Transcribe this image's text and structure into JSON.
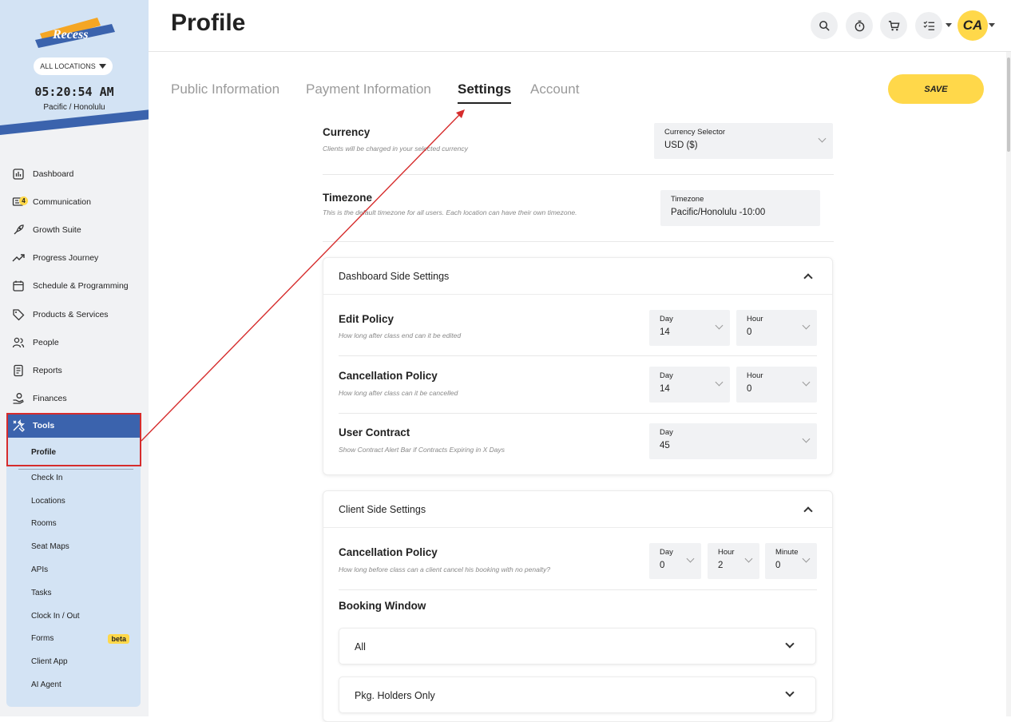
{
  "brand": {
    "logo_text": "Recess",
    "location_selector": "ALL LOCATIONS",
    "clock": "05:20:54 AM",
    "timezone": "Pacific / Honolulu"
  },
  "sidebar": {
    "items": [
      {
        "label": "Dashboard",
        "icon": "chart-icon"
      },
      {
        "label": "Communication",
        "icon": "message-icon",
        "badge": "4"
      },
      {
        "label": "Growth Suite",
        "icon": "rocket-icon"
      },
      {
        "label": "Progress Journey",
        "icon": "trend-icon"
      },
      {
        "label": "Schedule & Programming",
        "icon": "calendar-icon"
      },
      {
        "label": "Products & Services",
        "icon": "tag-icon"
      },
      {
        "label": "People",
        "icon": "people-icon"
      },
      {
        "label": "Reports",
        "icon": "report-icon"
      },
      {
        "label": "Finances",
        "icon": "finance-icon"
      }
    ],
    "tools": {
      "label": "Tools",
      "sub": [
        "Profile",
        "Check In",
        "Locations",
        "Rooms",
        "Seat Maps",
        "APIs",
        "Tasks",
        "Clock In / Out",
        "Forms",
        "Client App",
        "AI Agent"
      ],
      "beta_label": "beta"
    }
  },
  "header": {
    "title": "Profile",
    "avatar_initials": "CA"
  },
  "tabs": [
    "Public Information",
    "Payment Information",
    "Settings",
    "Account"
  ],
  "save_label": "SAVE",
  "currency": {
    "label": "Currency",
    "desc": "Clients will be charged in your selected currency",
    "select_label": "Currency Selector",
    "value": "USD ($)"
  },
  "timezone": {
    "label": "Timezone",
    "desc": "This is the default timezone for all users. Each location can have their own timezone.",
    "select_label": "Timezone",
    "value": "Pacific/Honolulu -10:00"
  },
  "dashboard_side": {
    "title": "Dashboard Side Settings",
    "edit": {
      "label": "Edit Policy",
      "desc": "How long after class end can it be edited",
      "day_label": "Day",
      "day": "14",
      "hour_label": "Hour",
      "hour": "0"
    },
    "cancel": {
      "label": "Cancellation Policy",
      "desc": "How long after class can it be cancelled",
      "day_label": "Day",
      "day": "14",
      "hour_label": "Hour",
      "hour": "0"
    },
    "contract": {
      "label": "User Contract",
      "desc": "Show Contract Alert Bar if Contracts Expiring in X Days",
      "day_label": "Day",
      "day": "45"
    }
  },
  "client_side": {
    "title": "Client Side Settings",
    "cancel": {
      "label": "Cancellation Policy",
      "desc": "How long before class can a client cancel his booking with no penalty?",
      "day_label": "Day",
      "day": "0",
      "hour_label": "Hour",
      "hour": "2",
      "minute_label": "Minute",
      "minute": "0"
    },
    "booking_window": "Booking Window",
    "accordions": [
      "All",
      "Pkg. Holders Only"
    ]
  },
  "colors": {
    "accent": "#ffd84a",
    "brand_blue": "#3b63ad",
    "annotation_red": "#d62c2c"
  }
}
